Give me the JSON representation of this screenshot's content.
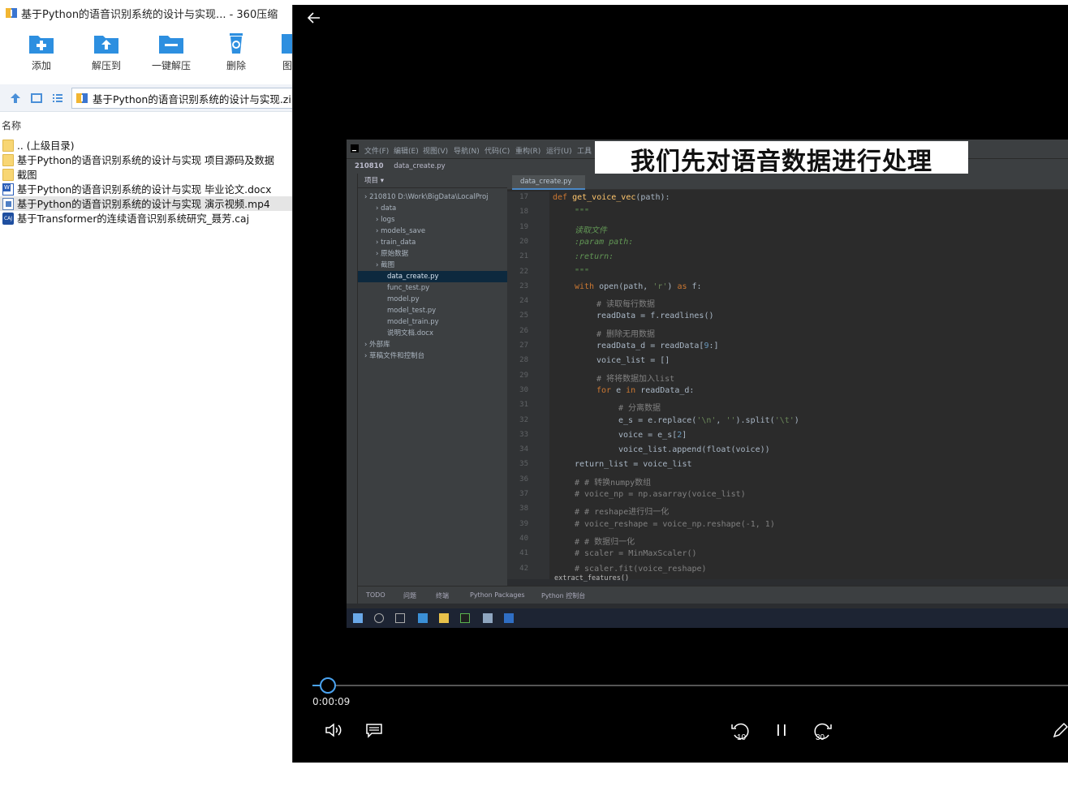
{
  "zip_window": {
    "title": "基于Python的语音识别系统的设计与实现... - 360压缩",
    "toolbar": [
      "添加",
      "解压到",
      "一键解压",
      "删除",
      "图"
    ],
    "address": "基于Python的语音识别系统的设计与实现.zip\\基",
    "column_name": "名称",
    "files": [
      {
        "name": ".. (上级目录)",
        "icon": "folder-icon"
      },
      {
        "name": "基于Python的语音识别系统的设计与实现 项目源码及数据",
        "icon": "folder-icon"
      },
      {
        "name": "截图",
        "icon": "folder-icon"
      },
      {
        "name": "基于Python的语音识别系统的设计与实现 毕业论文.docx",
        "icon": "word-doc-icon"
      },
      {
        "name": "基于Python的语音识别系统的设计与实现 演示视频.mp4",
        "icon": "video-file-icon",
        "selected": true
      },
      {
        "name": "基于Transformer的连续语音识别系统研究_聂芳.caj",
        "icon": "caj-file-icon"
      }
    ],
    "icon_badge": "CAJ"
  },
  "video": {
    "subtitle": "我们先对语音数据进行处理",
    "current_time": "0:00:09",
    "progress": 0.02,
    "skip_back_label": "10",
    "skip_forward_label": "30",
    "ide": {
      "menu": [
        "文件(F)",
        "编辑(E)",
        "视图(V)",
        "导航(N)",
        "代码(C)",
        "重构(R)",
        "运行(U)",
        "工具"
      ],
      "project_name": "210810",
      "current_file": "data_create.py",
      "project_label": "项目 ▾",
      "tree": [
        {
          "label": "210810  D:\\Work\\BigData\\LocalProj",
          "indent": 0
        },
        {
          "label": "data",
          "indent": 1
        },
        {
          "label": "logs",
          "indent": 1
        },
        {
          "label": "models_save",
          "indent": 1
        },
        {
          "label": "train_data",
          "indent": 1
        },
        {
          "label": "原始数据",
          "indent": 1
        },
        {
          "label": "截图",
          "indent": 1
        },
        {
          "label": "data_create.py",
          "indent": 2,
          "selected": true
        },
        {
          "label": "func_test.py",
          "indent": 2
        },
        {
          "label": "model.py",
          "indent": 2
        },
        {
          "label": "model_test.py",
          "indent": 2
        },
        {
          "label": "model_train.py",
          "indent": 2
        },
        {
          "label": "说明文档.docx",
          "indent": 2
        },
        {
          "label": "外部库",
          "indent": 0
        },
        {
          "label": "草稿文件和控制台",
          "indent": 0
        }
      ],
      "line_numbers": [
        "17",
        "18",
        "19",
        "20",
        "21",
        "22",
        "23",
        "24",
        "25",
        "26",
        "27",
        "28",
        "29",
        "30",
        "31",
        "32",
        "33",
        "34",
        "35",
        "36",
        "37",
        "38",
        "39",
        "40",
        "41",
        "42"
      ],
      "code": [
        {
          "indent": 0,
          "tokens": [
            [
              "kw",
              "def "
            ],
            [
              "fn",
              "get_voice_vec"
            ],
            [
              "",
              "(path):"
            ]
          ]
        },
        {
          "indent": 1,
          "tokens": [
            [
              "doc",
              "\"\"\""
            ]
          ]
        },
        {
          "indent": 1,
          "tokens": [
            [
              "doc",
              "读取文件"
            ]
          ]
        },
        {
          "indent": 1,
          "tokens": [
            [
              "doc",
              ":param path:"
            ]
          ]
        },
        {
          "indent": 1,
          "tokens": [
            [
              "doc",
              ":return:"
            ]
          ]
        },
        {
          "indent": 1,
          "tokens": [
            [
              "doc",
              "\"\"\""
            ]
          ]
        },
        {
          "indent": 1,
          "tokens": [
            [
              "kw",
              "with "
            ],
            [
              "",
              "open(path, "
            ],
            [
              "st",
              "'r'"
            ],
            [
              "",
              ") "
            ],
            [
              "kw",
              "as "
            ],
            [
              "",
              "f:"
            ]
          ]
        },
        {
          "indent": 2,
          "tokens": [
            [
              "cm",
              "# 读取每行数据"
            ]
          ]
        },
        {
          "indent": 2,
          "tokens": [
            [
              "",
              "readData = f.readlines()"
            ]
          ]
        },
        {
          "indent": 2,
          "tokens": [
            [
              "cm",
              "# 删除无用数据"
            ]
          ]
        },
        {
          "indent": 2,
          "tokens": [
            [
              "",
              "readData_d = readData["
            ],
            [
              "nu",
              "9"
            ],
            [
              "",
              ":]"
            ]
          ]
        },
        {
          "indent": 2,
          "tokens": [
            [
              "",
              "voice_list = []"
            ]
          ]
        },
        {
          "indent": 2,
          "tokens": [
            [
              "cm",
              "# 将将数据加入list"
            ]
          ]
        },
        {
          "indent": 2,
          "tokens": [
            [
              "kw",
              "for "
            ],
            [
              "",
              "e "
            ],
            [
              "kw",
              "in "
            ],
            [
              "",
              "readData_d:"
            ]
          ]
        },
        {
          "indent": 3,
          "tokens": [
            [
              "cm",
              "# 分离数据"
            ]
          ]
        },
        {
          "indent": 3,
          "tokens": [
            [
              "",
              "e_s = e.replace("
            ],
            [
              "st",
              "'\\n'"
            ],
            [
              "",
              ", "
            ],
            [
              "st",
              "''"
            ],
            [
              "",
              ").split("
            ],
            [
              "st",
              "'\\t'"
            ],
            [
              "",
              ")"
            ]
          ]
        },
        {
          "indent": 3,
          "tokens": [
            [
              "",
              "voice = e_s["
            ],
            [
              "nu",
              "2"
            ],
            [
              "",
              "]"
            ]
          ]
        },
        {
          "indent": 3,
          "tokens": [
            [
              "",
              "voice_list.append(float(voice))"
            ]
          ]
        },
        {
          "indent": 1,
          "tokens": [
            [
              "",
              "return_list = voice_list"
            ]
          ]
        },
        {
          "indent": 1,
          "tokens": [
            [
              "cm",
              "# # 转换numpy数组"
            ]
          ]
        },
        {
          "indent": 1,
          "tokens": [
            [
              "cm",
              "# voice_np = np.asarray(voice_list)"
            ]
          ]
        },
        {
          "indent": 1,
          "tokens": [
            [
              "cm",
              "# # reshape进行归一化"
            ]
          ]
        },
        {
          "indent": 1,
          "tokens": [
            [
              "cm",
              "# voice_reshape = voice_np.reshape(-1, 1)"
            ]
          ]
        },
        {
          "indent": 1,
          "tokens": [
            [
              "cm",
              "# # 数据归一化"
            ]
          ]
        },
        {
          "indent": 1,
          "tokens": [
            [
              "cm",
              "# scaler = MinMaxScaler()"
            ]
          ]
        },
        {
          "indent": 1,
          "tokens": [
            [
              "cm",
              "# scaler.fit(voice_reshape)"
            ]
          ]
        }
      ],
      "bottom_tabs": [
        "TODO",
        "问题",
        "终端",
        "Python Packages",
        "Python 控制台"
      ],
      "func_hint": "extract_features()"
    }
  },
  "colors": {
    "accent": "#4aa3f0",
    "folder": "#f8d674",
    "zip_blue": "#2d8fe0"
  }
}
